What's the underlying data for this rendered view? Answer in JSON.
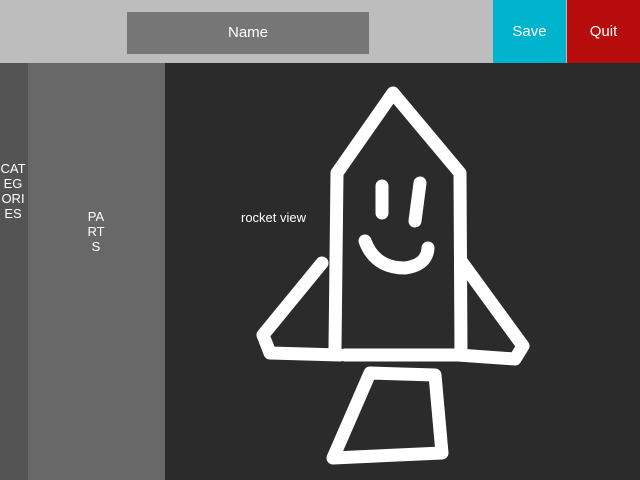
{
  "header": {
    "name_field": {
      "value": "Name"
    },
    "save_label": "Save",
    "quit_label": "Quit"
  },
  "sidebar": {
    "categories_label": "CATEGORIES",
    "parts_label": "PARTS"
  },
  "viewport": {
    "label": "rocket view",
    "drawing_icon": "rocket-sketch"
  },
  "colors": {
    "save": "#00b4cd",
    "quit": "#b70d0d",
    "topbar": "#bdbdbd",
    "name_field": "#767676",
    "categories_panel": "#545454",
    "parts_panel": "#686868",
    "viewport": "#2b2b2b"
  }
}
